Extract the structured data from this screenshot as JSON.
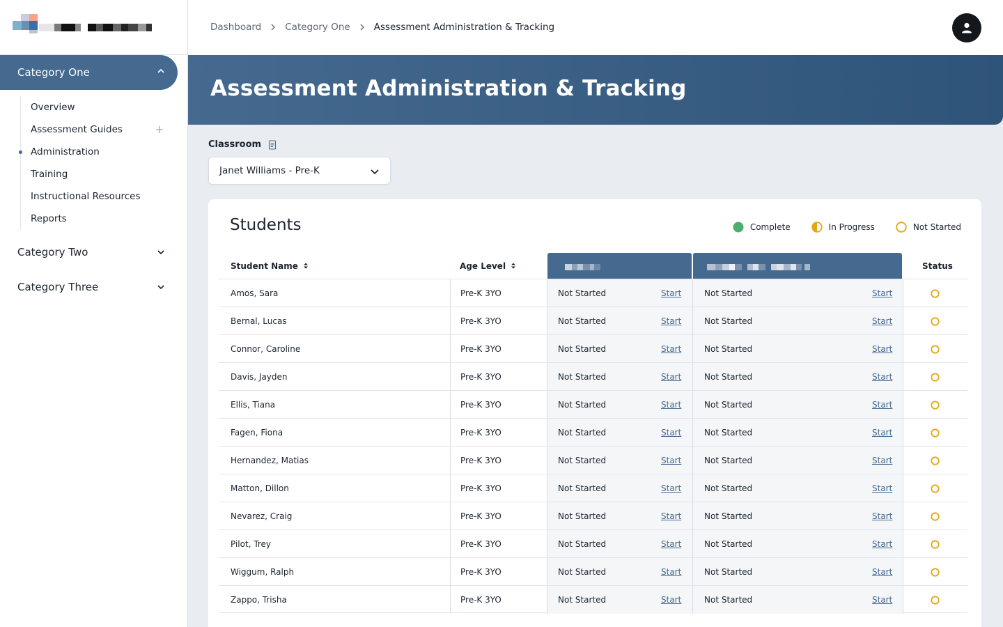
{
  "sidebar": {
    "active_category": "Category One",
    "items": [
      {
        "label": "Overview"
      },
      {
        "label": "Assessment Guides"
      },
      {
        "label": "Administration"
      },
      {
        "label": "Training"
      },
      {
        "label": "Instructional Resources"
      },
      {
        "label": "Reports"
      }
    ],
    "categories": [
      {
        "label": "Category Two"
      },
      {
        "label": "Category Three"
      }
    ]
  },
  "breadcrumb": [
    "Dashboard",
    "Category One",
    "Assessment Administration & Tracking"
  ],
  "page_title": "Assessment Administration & Tracking",
  "classroom": {
    "label": "Classroom",
    "selected": "Janet Williams - Pre-K"
  },
  "students": {
    "title": "Students",
    "legend": {
      "complete": "Complete",
      "in_progress": "In Progress",
      "not_started": "Not Started"
    },
    "columns": {
      "name": "Student Name",
      "age": "Age Level",
      "status": "Status"
    },
    "colors": {
      "accent": "#45698f",
      "complete": "#4caf6e",
      "pending": "#e5a614"
    },
    "rows": [
      {
        "name": "Amos, Sara",
        "age": "Pre-K 3YO",
        "a1": "Not Started",
        "a2": "Not Started",
        "start": "Start"
      },
      {
        "name": "Bernal, Lucas",
        "age": "Pre-K 3YO",
        "a1": "Not Started",
        "a2": "Not Started",
        "start": "Start"
      },
      {
        "name": "Connor, Caroline",
        "age": "Pre-K 3YO",
        "a1": "Not Started",
        "a2": "Not Started",
        "start": "Start"
      },
      {
        "name": "Davis, Jayden",
        "age": "Pre-K 3YO",
        "a1": "Not Started",
        "a2": "Not Started",
        "start": "Start"
      },
      {
        "name": "Ellis, Tiana",
        "age": "Pre-K 3YO",
        "a1": "Not Started",
        "a2": "Not Started",
        "start": "Start"
      },
      {
        "name": "Fagen, Fiona",
        "age": "Pre-K 3YO",
        "a1": "Not Started",
        "a2": "Not Started",
        "start": "Start"
      },
      {
        "name": "Hernandez, Matias",
        "age": "Pre-K 3YO",
        "a1": "Not Started",
        "a2": "Not Started",
        "start": "Start"
      },
      {
        "name": "Matton, Dillon",
        "age": "Pre-K 3YO",
        "a1": "Not Started",
        "a2": "Not Started",
        "start": "Start"
      },
      {
        "name": "Nevarez, Craig",
        "age": "Pre-K 3YO",
        "a1": "Not Started",
        "a2": "Not Started",
        "start": "Start"
      },
      {
        "name": "Pilot, Trey",
        "age": "Pre-K 3YO",
        "a1": "Not Started",
        "a2": "Not Started",
        "start": "Start"
      },
      {
        "name": "Wiggum, Ralph",
        "age": "Pre-K 3YO",
        "a1": "Not Started",
        "a2": "Not Started",
        "start": "Start"
      },
      {
        "name": "Zappo, Trisha",
        "age": "Pre-K 3YO",
        "a1": "Not Started",
        "a2": "Not Started",
        "start": "Start"
      }
    ]
  }
}
